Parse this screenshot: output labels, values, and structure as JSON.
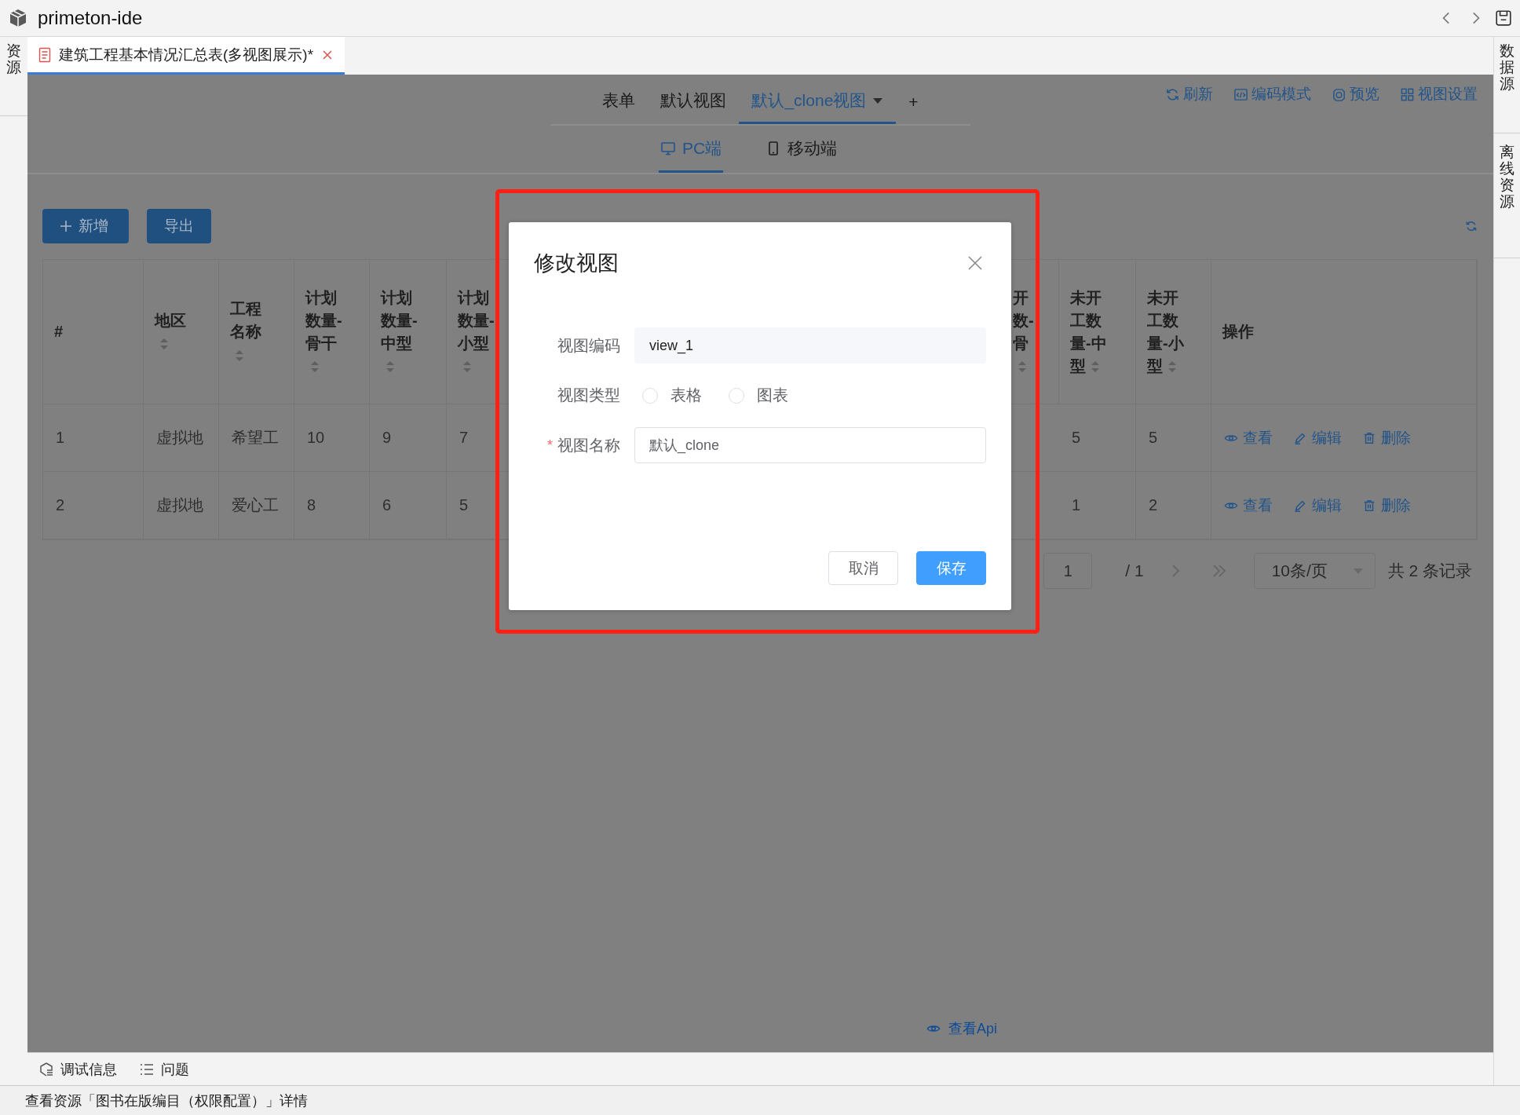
{
  "window": {
    "title": "primeton-ide"
  },
  "left_sidebar": {
    "items": [
      {
        "label": "资源"
      }
    ]
  },
  "right_sidebar": {
    "items": [
      {
        "label": "数据源"
      },
      {
        "label": "离线资源"
      }
    ]
  },
  "editor_tabs": [
    {
      "label": "建筑工程基本情况汇总表(多视图展示)*",
      "selected": true
    }
  ],
  "view_tabs": [
    {
      "label": "表单",
      "selected": false,
      "dropdown": false
    },
    {
      "label": "默认视图",
      "selected": false,
      "dropdown": false
    },
    {
      "label": "默认_clone视图",
      "selected": true,
      "dropdown": true
    }
  ],
  "add_view": "+",
  "toolbar": [
    {
      "label": "刷新",
      "kind": "refresh"
    },
    {
      "label": "编码模式",
      "kind": "code"
    },
    {
      "label": "预览",
      "kind": "preview"
    },
    {
      "label": "视图设置",
      "kind": "settings"
    }
  ],
  "device_tabs": [
    {
      "label": "PC端",
      "kind": "pc",
      "selected": true
    },
    {
      "label": "移动端",
      "kind": "mobile",
      "selected": false
    }
  ],
  "actions": [
    {
      "label": "新增",
      "kind": "add"
    },
    {
      "label": "导出",
      "kind": "plain"
    }
  ],
  "table": {
    "columns": [
      {
        "label": "#",
        "kind": "data",
        "sortable": false
      },
      {
        "label": "地区",
        "kind": "data",
        "sortable": true
      },
      {
        "label": "工程名称",
        "kind": "data",
        "sortable": true
      },
      {
        "label": "计划数量-骨干",
        "kind": "data",
        "sortable": true
      },
      {
        "label": "计划数量-中型",
        "kind": "data",
        "sortable": true
      },
      {
        "label": "计划数量-小型",
        "kind": "data",
        "sortable": true
      },
      {
        "label": "开数-骨",
        "kind": "cut",
        "sortable": true
      },
      {
        "label": "未开工数量-中型",
        "kind": "data",
        "sortable": true
      },
      {
        "label": "未开工数量-小型",
        "kind": "data",
        "sortable": true
      },
      {
        "label": "操作",
        "kind": "actions",
        "sortable": false
      }
    ],
    "rows": [
      {
        "cells": [
          "1",
          "虚拟地",
          "希望工",
          "10",
          "9",
          "7",
          "",
          "5",
          "5"
        ],
        "actions": [
          {
            "label": "查看",
            "kind": "view"
          },
          {
            "label": "编辑",
            "kind": "edit"
          },
          {
            "label": "删除",
            "kind": "delete"
          }
        ]
      },
      {
        "cells": [
          "2",
          "虚拟地",
          "爱心工",
          "8",
          "6",
          "5",
          "",
          "1",
          "2"
        ],
        "actions": [
          {
            "label": "查看",
            "kind": "view"
          },
          {
            "label": "编辑",
            "kind": "edit"
          },
          {
            "label": "删除",
            "kind": "delete"
          }
        ]
      }
    ]
  },
  "pagination": {
    "page": "1",
    "total_pages": "/ 1",
    "page_size": "10条/页",
    "total": "共 2 条记录"
  },
  "api_link": "查看Api",
  "bottom_tabs": [
    {
      "label": "调试信息",
      "kind": "debug"
    },
    {
      "label": "问题",
      "kind": "problems"
    }
  ],
  "status_bar": "查看资源「图书在版编目（权限配置）」详情",
  "dialog": {
    "title": "修改视图",
    "fields": [
      {
        "kind": "text",
        "label": "视图编码",
        "value": "view_1",
        "disabled": true
      },
      {
        "kind": "radio",
        "label": "视图类型",
        "options": [
          {
            "label": "表格",
            "selected": false
          },
          {
            "label": "图表",
            "selected": false
          }
        ]
      },
      {
        "kind": "text",
        "label": "视图名称",
        "value": "默认_clone",
        "disabled": false,
        "required_mark": "*"
      }
    ],
    "buttons": [
      {
        "label": "取消",
        "primary": false
      },
      {
        "label": "保存",
        "primary": true
      }
    ]
  }
}
